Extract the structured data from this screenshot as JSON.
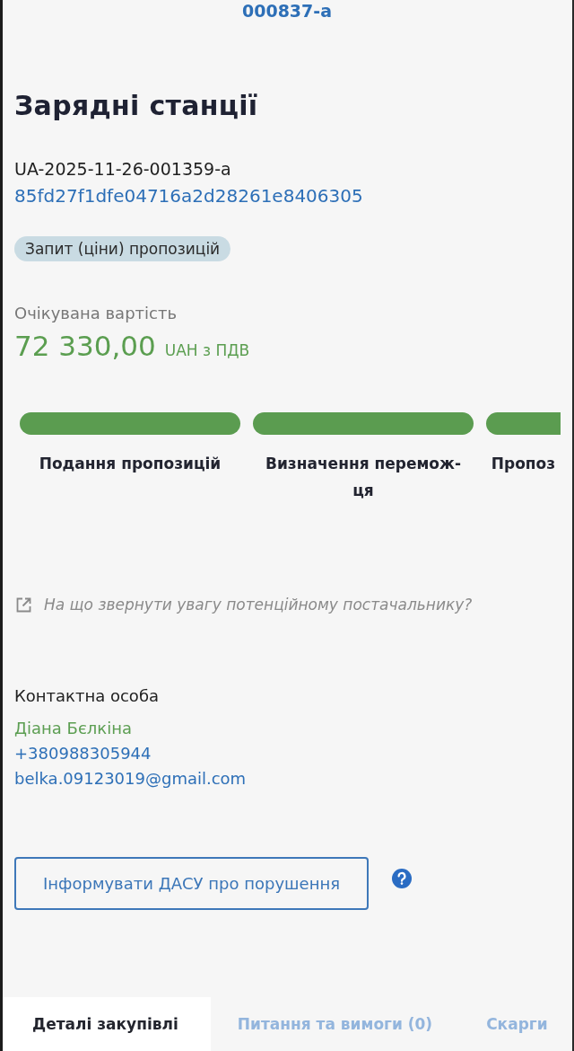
{
  "header": {
    "linked_id": "000837-a"
  },
  "tender": {
    "title": "Зарядні станції",
    "tender_id": "UA-2025-11-26-001359-a",
    "hash": "85fd27f1dfe04716a2d28261e8406305",
    "status_badge": "Запит (ціни) пропозицій"
  },
  "expected_value": {
    "label": "Очікувана вартість",
    "amount": "72 330,00",
    "currency": "UAH з ПДВ"
  },
  "stages": [
    {
      "label": "Подання пропозицій",
      "done": true
    },
    {
      "label": "Визначення перемож-ця",
      "done": true
    },
    {
      "label": "Пропоз",
      "done": true
    }
  ],
  "supplier_tip_link": "На що звернути увагу потенційному постачальнику?",
  "contact": {
    "heading": "Контактна особа",
    "name": "Діана Бєлкіна",
    "phone": "+380988305944",
    "email": "belka.09123019@gmail.com"
  },
  "report_button": "Інформувати ДАСУ про порушення",
  "tabs": [
    {
      "label": "Деталі закупівлі",
      "selected": true
    },
    {
      "label": "Питання та вимоги (0)",
      "selected": false
    },
    {
      "label": "Скарги",
      "selected": false
    }
  ]
}
